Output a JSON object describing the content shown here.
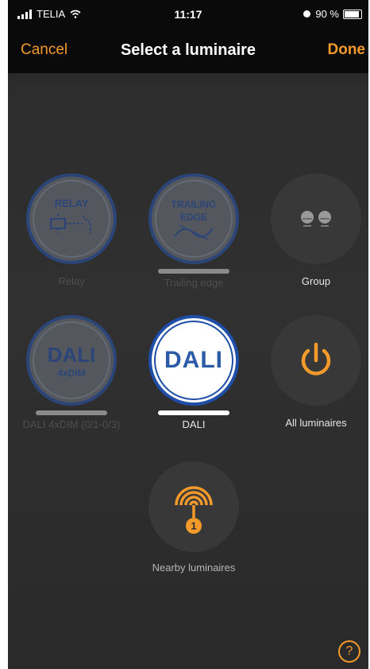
{
  "status_bar": {
    "carrier": "TELIA",
    "time": "11:17",
    "battery": "90 %"
  },
  "nav": {
    "cancel_label": "Cancel",
    "title": "Select a luminaire",
    "done_label": "Done"
  },
  "options": [
    {
      "icon_text": "RELAY",
      "label": "Relay",
      "state": "disabled"
    },
    {
      "icon_text_line1": "TRAILING",
      "icon_text_line2": "EDGE",
      "label": "Trailing edge",
      "state": "disabled"
    },
    {
      "label": "Group",
      "state": "available"
    },
    {
      "icon_text_line1": "DALI",
      "icon_text_line2": "4xDIM",
      "label": "DALI 4xDIM (0/1-0/3)",
      "state": "disabled"
    },
    {
      "icon_text": "DALI",
      "label": "DALI",
      "state": "selected"
    },
    {
      "label": "All luminaires",
      "state": "available"
    },
    {
      "badge": "1",
      "label": "Nearby luminaires",
      "state": "available"
    }
  ],
  "help": {
    "icon": "question-mark-icon",
    "glyph": "?"
  },
  "colors": {
    "accent": "#f39a2b",
    "dali_blue": "#1f4ea8",
    "background": "#2d2d2d"
  }
}
